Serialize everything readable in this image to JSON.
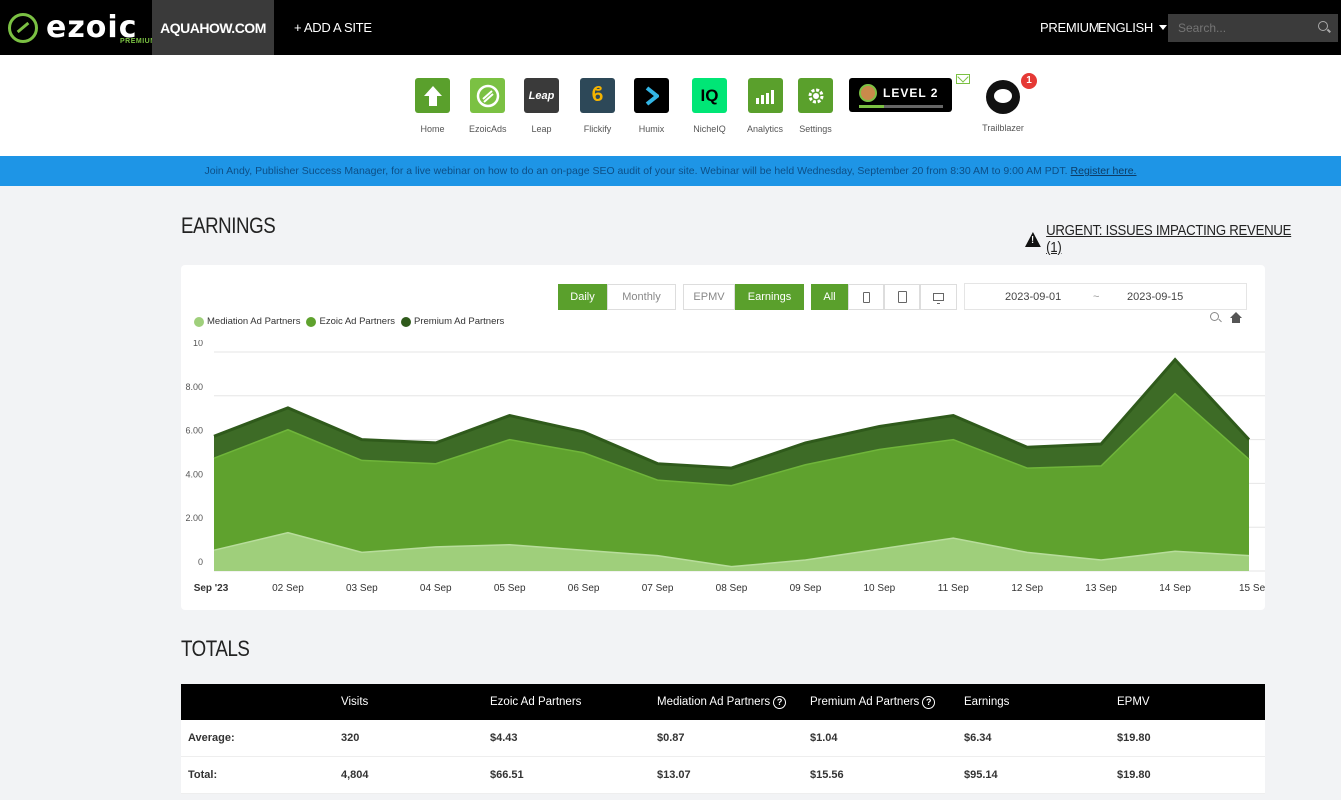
{
  "topnav": {
    "logo_text": "ezoic",
    "logo_sub": "PREMIUM",
    "site": "AQUAHOW.COM",
    "add_site": "+ ADD A SITE",
    "premium": "PREMIUM",
    "language": "ENGLISH",
    "search_placeholder": "Search..."
  },
  "apps": [
    {
      "label": "Home",
      "icon": "home-icon",
      "color": "#5aa02c"
    },
    {
      "label": "EzoicAds",
      "icon": "ezoicads-icon",
      "color": "#7bc143"
    },
    {
      "label": "Leap",
      "icon": "leap-icon",
      "color": "#3a3a3a"
    },
    {
      "label": "Flickify",
      "icon": "flickify-icon",
      "color": "#2d4858"
    },
    {
      "label": "Humix",
      "icon": "humix-icon",
      "color": "#000000"
    },
    {
      "label": "NicheIQ",
      "icon": "nicheiq-icon",
      "color": "#00e676"
    },
    {
      "label": "Analytics",
      "icon": "analytics-icon",
      "color": "#5aa02c"
    },
    {
      "label": "Settings",
      "icon": "settings-icon",
      "color": "#5aa02c"
    }
  ],
  "level": {
    "text": "LEVEL 2",
    "progress": 0.3
  },
  "trailblazer": {
    "label": "Trailblazer",
    "badge": "1"
  },
  "banner": {
    "text": "Join Andy, Publisher Success Manager, for a live webinar on how to do an on-page SEO audit of your site. Webinar will be held Wednesday, September 20 from 8:30 AM to 9:00 AM PDT.",
    "link": "Register here."
  },
  "earnings": {
    "title": "EARNINGS",
    "urgent": "URGENT: ISSUES IMPACTING REVENUE (1)",
    "controls": {
      "daily": "Daily",
      "monthly": "Monthly",
      "epmv": "EPMV",
      "earnings": "Earnings",
      "all": "All",
      "date_from": "2023-09-01",
      "date_sep": "~",
      "date_to": "2023-09-15"
    }
  },
  "chart_data": {
    "type": "area",
    "stacked": true,
    "categories": [
      "Sep '23",
      "02 Sep",
      "03 Sep",
      "04 Sep",
      "05 Sep",
      "06 Sep",
      "07 Sep",
      "08 Sep",
      "09 Sep",
      "10 Sep",
      "11 Sep",
      "12 Sep",
      "13 Sep",
      "14 Sep",
      "15 Se"
    ],
    "y_ticks": [
      "10",
      "8.00",
      "6.00",
      "4.00",
      "2.00",
      "0"
    ],
    "ylim": [
      0,
      10
    ],
    "series": [
      {
        "name": "Mediation Ad Partners",
        "color": "#9fcf7b",
        "values": [
          0.95,
          1.75,
          0.85,
          1.1,
          1.2,
          0.95,
          0.7,
          0.2,
          0.5,
          1.0,
          1.5,
          0.85,
          0.5,
          0.9,
          0.7
        ]
      },
      {
        "name": "Ezoic Ad Partners",
        "color": "#5fa22e",
        "values": [
          4.2,
          4.7,
          4.2,
          3.8,
          4.8,
          4.45,
          3.45,
          3.7,
          4.35,
          4.55,
          4.5,
          3.85,
          4.3,
          7.2,
          4.4
        ]
      },
      {
        "name": "Premium Ad Partners",
        "color": "#3d6b26",
        "values": [
          1.0,
          1.0,
          0.95,
          0.95,
          1.1,
          0.95,
          0.75,
          0.8,
          1.0,
          1.05,
          1.1,
          0.95,
          1.0,
          1.55,
          0.9
        ]
      }
    ],
    "legend_position": "top-left",
    "grid": true
  },
  "totals": {
    "title": "TOTALS",
    "headers": [
      "",
      "Visits",
      "Ezoic Ad Partners",
      "Mediation Ad Partners",
      "Premium Ad Partners",
      "Earnings",
      "EPMV"
    ],
    "rows": [
      [
        "Average:",
        "320",
        "$4.43",
        "$0.87",
        "$1.04",
        "$6.34",
        "$19.80"
      ],
      [
        "Total:",
        "4,804",
        "$66.51",
        "$13.07",
        "$15.56",
        "$95.14",
        "$19.80"
      ]
    ]
  }
}
